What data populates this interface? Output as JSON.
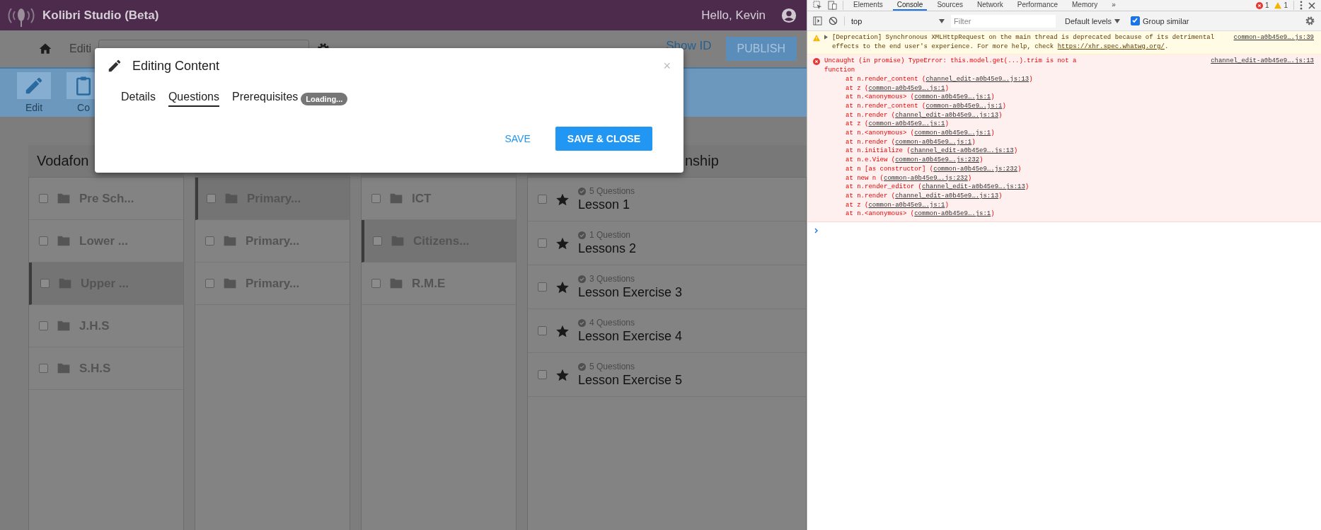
{
  "app": {
    "header": {
      "title": "Kolibri Studio (Beta)",
      "greeting": "Hello, Kevin"
    },
    "topbar": {
      "editing_label": "Editi",
      "show_id": "Show ID",
      "publish": "PUBLISH"
    },
    "toolbar": [
      {
        "label": "Edit",
        "kind": "edit"
      },
      {
        "label": "Co",
        "kind": "copy"
      }
    ],
    "columns": [
      {
        "header": "Vodafon",
        "items": [
          {
            "kind": "folder",
            "label": "Pre Sch...",
            "selected": false,
            "checked": false
          },
          {
            "kind": "folder",
            "label": "Lower ...",
            "selected": false,
            "checked": false
          },
          {
            "kind": "folder",
            "label": "Upper ...",
            "selected": true,
            "checked": false
          },
          {
            "kind": "folder",
            "label": "J.H.S",
            "selected": false,
            "checked": false
          },
          {
            "kind": "folder",
            "label": "S.H.S",
            "selected": false,
            "checked": false
          }
        ]
      },
      {
        "items": [
          {
            "kind": "folder",
            "label": "Primary...",
            "selected": true,
            "checked": false
          },
          {
            "kind": "folder",
            "label": "Primary...",
            "selected": false,
            "checked": false
          },
          {
            "kind": "folder",
            "label": "Primary...",
            "selected": false,
            "checked": false
          }
        ]
      },
      {
        "items": [
          {
            "kind": "folder",
            "label": "ICT",
            "selected": false,
            "checked": false
          },
          {
            "kind": "folder",
            "label": "Citizens...",
            "selected": true,
            "checked": false
          },
          {
            "kind": "folder",
            "label": "R.M.E",
            "selected": false,
            "checked": false
          }
        ]
      },
      {
        "header": "nship",
        "items": [
          {
            "kind": "exercise",
            "label": "Lesson 1",
            "questions": "5 Questions",
            "selected": false,
            "checked": false
          },
          {
            "kind": "exercise",
            "label": "Lessons 2",
            "questions": "1 Question",
            "selected": false,
            "checked": false
          },
          {
            "kind": "exercise",
            "label": "Lesson Exercise 3",
            "questions": "3 Questions",
            "selected": false,
            "checked": false
          },
          {
            "kind": "exercise",
            "label": "Lesson Exercise 4",
            "questions": "4 Questions",
            "selected": false,
            "checked": false
          },
          {
            "kind": "exercise",
            "label": "Lesson Exercise 5",
            "questions": "5 Questions",
            "selected": false,
            "checked": false
          }
        ]
      }
    ]
  },
  "dialog": {
    "title": "Editing Content",
    "close": "×",
    "tabs": [
      {
        "label": "Details",
        "selected": false
      },
      {
        "label": "Questions",
        "selected": true
      },
      {
        "label": "Prerequisites",
        "selected": false,
        "badge": "Loading..."
      }
    ],
    "buttons": [
      {
        "label": "SAVE",
        "kind": "flat"
      },
      {
        "label": "SAVE & CLOSE",
        "kind": "raised"
      }
    ]
  },
  "devtools": {
    "tabs": [
      {
        "label": "Elements",
        "selected": false
      },
      {
        "label": "Console",
        "selected": true
      },
      {
        "label": "Sources",
        "selected": false
      },
      {
        "label": "Network",
        "selected": false
      },
      {
        "label": "Performance",
        "selected": false
      },
      {
        "label": "Memory",
        "selected": false
      }
    ],
    "more": "»",
    "error_count": "1",
    "warning_count": "1",
    "context": "top",
    "filter_placeholder": "Filter",
    "levels": "Default levels",
    "group_similar": {
      "label": "Group similar",
      "checked": true
    },
    "messages": [
      {
        "kind": "warning",
        "text": "[Deprecation] Synchronous XMLHttpRequest on the main thread is deprecated because of its detrimental effects to the end user's experience. For more help, check",
        "link": "https://xhr.spec.whatwg.org/",
        "tail": ".",
        "source": "common-a0b45e9….js:39"
      },
      {
        "kind": "error",
        "text": "Uncaught (in promise) TypeError: this.model.get(...).trim is not a function",
        "source": "channel_edit-a0b45e9….js:13",
        "stack": [
          {
            "call": "at n.render_content (",
            "source": "channel_edit-a0b45e9….js:13",
            "close": ")"
          },
          {
            "call": "at z (",
            "source": "common-a0b45e9….js:1",
            "close": ")"
          },
          {
            "call": "at n.<anonymous> (",
            "source": "common-a0b45e9….js:1",
            "close": ")"
          },
          {
            "call": "at n.render_content (",
            "source": "common-a0b45e9….js:1",
            "close": ")"
          },
          {
            "call": "at n.render (",
            "source": "channel_edit-a0b45e9….js:13",
            "close": ")"
          },
          {
            "call": "at z (",
            "source": "common-a0b45e9….js:1",
            "close": ")"
          },
          {
            "call": "at n.<anonymous> (",
            "source": "common-a0b45e9….js:1",
            "close": ")"
          },
          {
            "call": "at n.render (",
            "source": "common-a0b45e9….js:1",
            "close": ")"
          },
          {
            "call": "at n.initialize (",
            "source": "channel_edit-a0b45e9….js:13",
            "close": ")"
          },
          {
            "call": "at n.e.View (",
            "source": "common-a0b45e9….js:232",
            "close": ")"
          },
          {
            "call": "at n [as constructor] (",
            "source": "common-a0b45e9….js:232",
            "close": ")"
          },
          {
            "call": "at new n (",
            "source": "common-a0b45e9….js:232",
            "close": ")"
          },
          {
            "call": "at n.render_editor (",
            "source": "channel_edit-a0b45e9….js:13",
            "close": ")"
          },
          {
            "call": "at n.render (",
            "source": "channel_edit-a0b45e9….js:13",
            "close": ")"
          },
          {
            "call": "at z (",
            "source": "common-a0b45e9….js:1",
            "close": ")"
          },
          {
            "call": "at n.<anonymous> (",
            "source": "common-a0b45e9….js:1",
            "close": ")"
          }
        ]
      }
    ]
  }
}
